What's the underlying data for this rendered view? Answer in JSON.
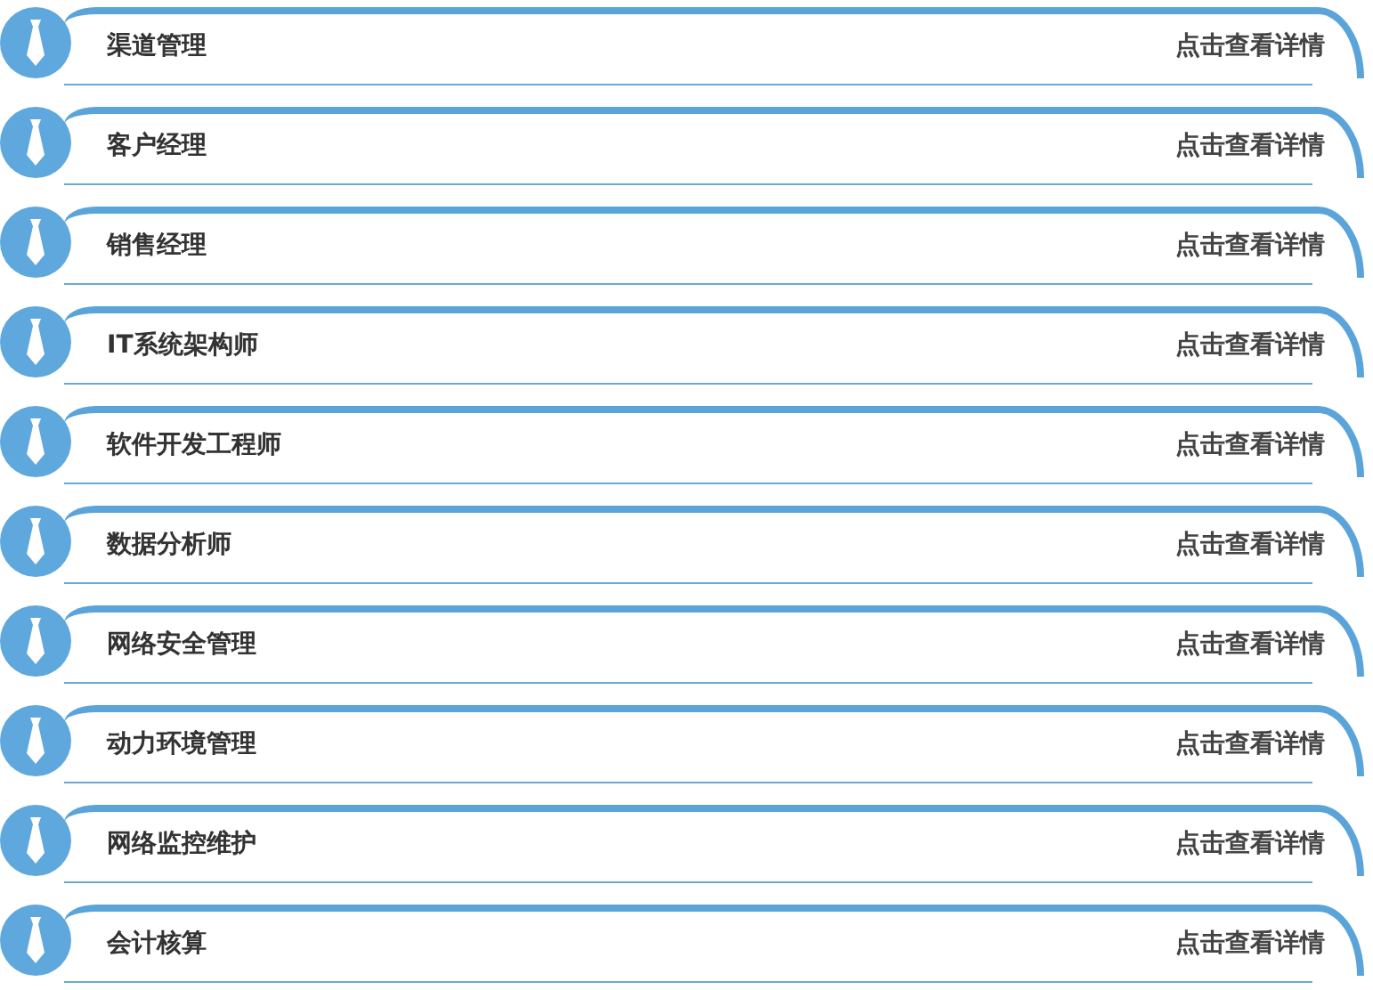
{
  "items": [
    {
      "title": "渠道管理",
      "link": "点击查看详情"
    },
    {
      "title": "客户经理",
      "link": "点击查看详情"
    },
    {
      "title": "销售经理",
      "link": "点击查看详情"
    },
    {
      "title": "IT系统架构师",
      "link": "点击查看详情"
    },
    {
      "title": "软件开发工程师",
      "link": "点击查看详情"
    },
    {
      "title": "数据分析师",
      "link": "点击查看详情"
    },
    {
      "title": "网络安全管理",
      "link": "点击查看详情"
    },
    {
      "title": "动力环境管理",
      "link": "点击查看详情"
    },
    {
      "title": "网络监控维护",
      "link": "点击查看详情"
    },
    {
      "title": "会计核算",
      "link": "点击查看详情"
    }
  ]
}
